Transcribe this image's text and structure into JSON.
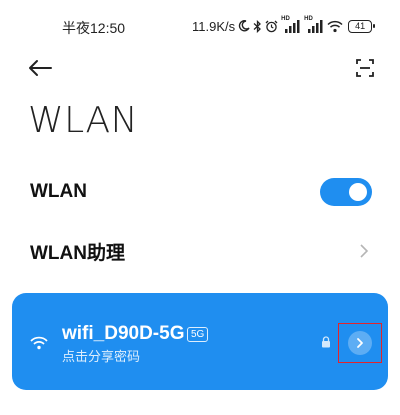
{
  "status_bar": {
    "time": "半夜12:50",
    "network_speed": "11.9K/s",
    "signal_1_label": "HD",
    "signal_2_label": "HD",
    "battery": "41",
    "icons": [
      "moon-icon",
      "bluetooth-icon",
      "alarm-icon",
      "signal-icon",
      "signal-icon",
      "wifi-icon",
      "battery-icon"
    ]
  },
  "header": {
    "title": "WLAN",
    "back_icon": "back-arrow-icon",
    "scan_icon": "scan-icon"
  },
  "settings": {
    "wlan_label": "WLAN",
    "wlan_enabled": true,
    "assistant_label": "WLAN助理"
  },
  "connected_network": {
    "ssid": "wifi_D90D-5G",
    "band_badge": "5G",
    "subtitle": "点击分享密码",
    "secured": true
  },
  "colors": {
    "accent": "#1f8ef0",
    "highlight_box": "#e3242b"
  }
}
